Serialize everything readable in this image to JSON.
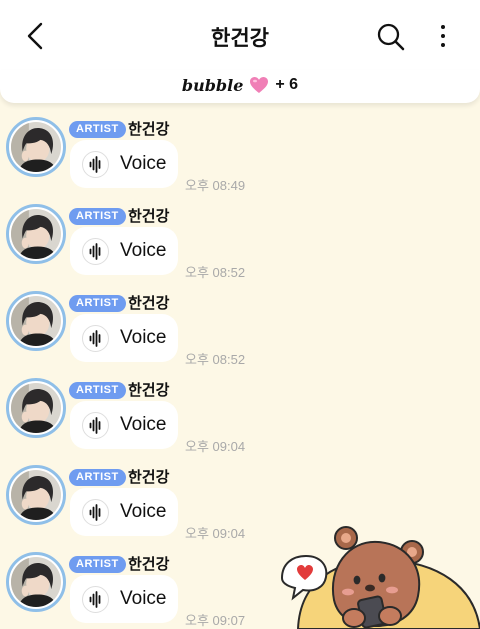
{
  "header": {
    "title": "한건강",
    "back_icon": "chevron-left-icon",
    "search_icon": "search-icon",
    "more_icon": "more-vertical-icon"
  },
  "subheader": {
    "brand": "bubble",
    "heart_color": "#f07fb6",
    "count": "+ 6"
  },
  "colors": {
    "background": "#fdf8e6",
    "badge": "#6f9cf0",
    "avatar_ring": "#8fbfe8"
  },
  "messages": [
    {
      "badge": "ARTIST",
      "name": "한건강",
      "label": "Voice",
      "time": "오후 08:49"
    },
    {
      "badge": "ARTIST",
      "name": "한건강",
      "label": "Voice",
      "time": "오후 08:52"
    },
    {
      "badge": "ARTIST",
      "name": "한건강",
      "label": "Voice",
      "time": "오후 08:52"
    },
    {
      "badge": "ARTIST",
      "name": "한건강",
      "label": "Voice",
      "time": "오후 09:04"
    },
    {
      "badge": "ARTIST",
      "name": "한건강",
      "label": "Voice",
      "time": "오후 09:04"
    },
    {
      "badge": "ARTIST",
      "name": "한건강",
      "label": "Voice",
      "time": "오후 09:07"
    }
  ]
}
